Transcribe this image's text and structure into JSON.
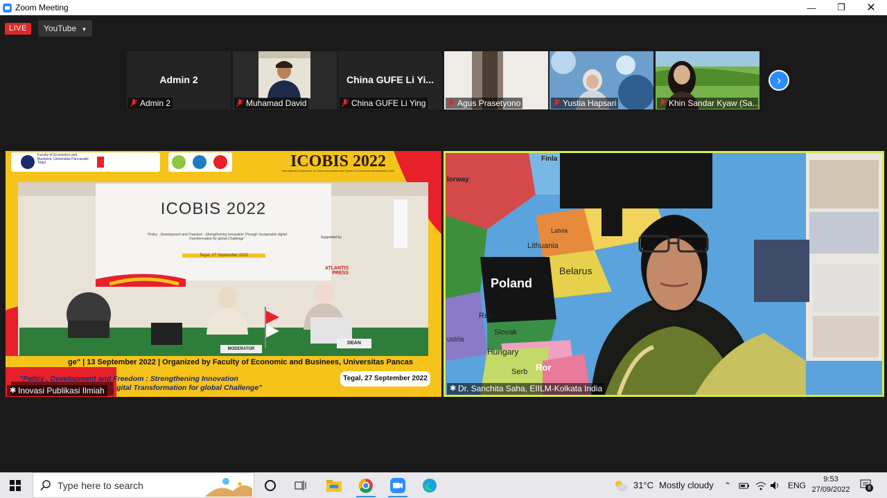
{
  "window": {
    "title": "Zoom Meeting"
  },
  "toolbar": {
    "live_label": "LIVE",
    "stream_label": "YouTube"
  },
  "participants": [
    {
      "big_label": "Admin 2",
      "name": "Admin 2"
    },
    {
      "big_label": "",
      "name": "Muhamad David"
    },
    {
      "big_label": "China GUFE Li Yi...",
      "name": "China GUFE Li Ying"
    },
    {
      "big_label": "",
      "name": "Agus Prasetyono"
    },
    {
      "big_label": "",
      "name": "Yustia Hapsari"
    },
    {
      "big_label": "",
      "name": "Khin Sandar Kyaw (Sa..."
    }
  ],
  "main_videos": {
    "left": {
      "name": "Inovasi Publikasi Ilmiah",
      "event_title": "ICOBIS 2022",
      "event_sub": "International Conference on Global Innovation and Trends in Economics and Business 2022",
      "banner_title": "ICOBIS 2022",
      "banner_theme": "\"Policy , Development and Freedom : Strengthening Innovation Through Sustainable digital Transformation for global Challenge\"",
      "banner_date": "Tegal, 27 September 2022",
      "supported": "Supported by",
      "sponsor": "ATLANTIS PRESS",
      "moderator_sign": "MODERATOR",
      "dean_sign": "DEAN",
      "ticker": "ge\" | 13 September 2022 | Organized by Faculty of Economic and Businees, Universitas Pancas",
      "footer_theme_1": "\"Policy , Development and Freedom : Strengthening Innovation",
      "footer_theme_2": "gital Transformation for global Challenge\"",
      "footer_date": "Tegal, 27 September 2022",
      "faculty_logo": "Faculty of Economics and Business, Universitas Pancasakti Tegal"
    },
    "right": {
      "name": "Dr. Sanchita Saha, EIILM-Kolkata India",
      "map_labels": [
        "Finla",
        "lorway",
        "Latvia",
        "Lithuania",
        "Belarus",
        "Poland",
        "Rep",
        "Slovak",
        "Hungary",
        "Serb",
        "Ror",
        "ustria"
      ]
    }
  },
  "taskbar": {
    "search_placeholder": "Type here to search",
    "weather_temp": "31°C",
    "weather_desc": "Mostly cloudy",
    "language": "ENG",
    "time": "9:53",
    "date": "27/09/2022",
    "notification_count": "8"
  },
  "colors": {
    "accent": "#2d8cff",
    "live_red": "#e02828",
    "active_border": "#d9e84b",
    "banner_yellow": "#f6c31b",
    "banner_red": "#e8202a"
  }
}
